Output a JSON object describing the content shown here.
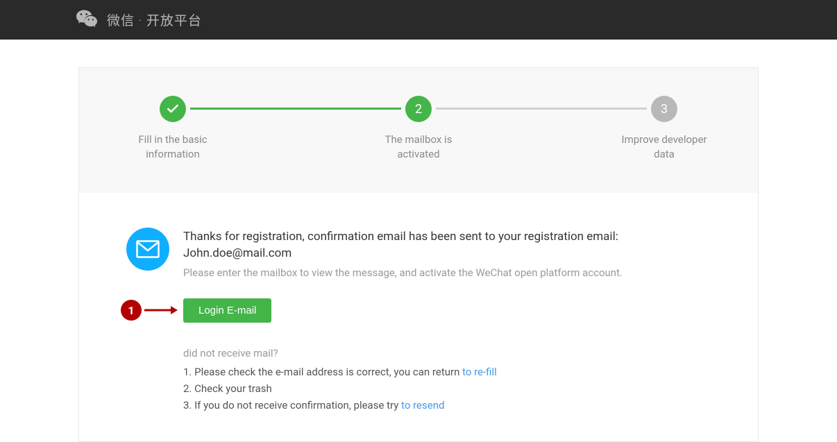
{
  "header": {
    "title": "微信 · 开放平台"
  },
  "steps": {
    "step1": {
      "label": "Fill in the basic information"
    },
    "step2": {
      "number": "2",
      "label": "The mailbox is activated"
    },
    "step3": {
      "number": "3",
      "label": "Improve developer data"
    }
  },
  "confirmation": {
    "title": "Thanks for registration, confirmation email has been sent to your registration email: John.doe@mail.com",
    "subtitle": "Please enter the mailbox to view the message, and activate the WeChat open platform account."
  },
  "login_button_label": "Login E-mail",
  "help": {
    "title": "did not receive mail?",
    "line1_prefix": "1. Please check the e-mail address is correct, you can return ",
    "line1_link": "to re-fill",
    "line2": "2. Check your trash",
    "line3_prefix": "3. If you do not receive confirmation, please try ",
    "line3_link": "to resend"
  },
  "annotation": {
    "number": "1"
  }
}
